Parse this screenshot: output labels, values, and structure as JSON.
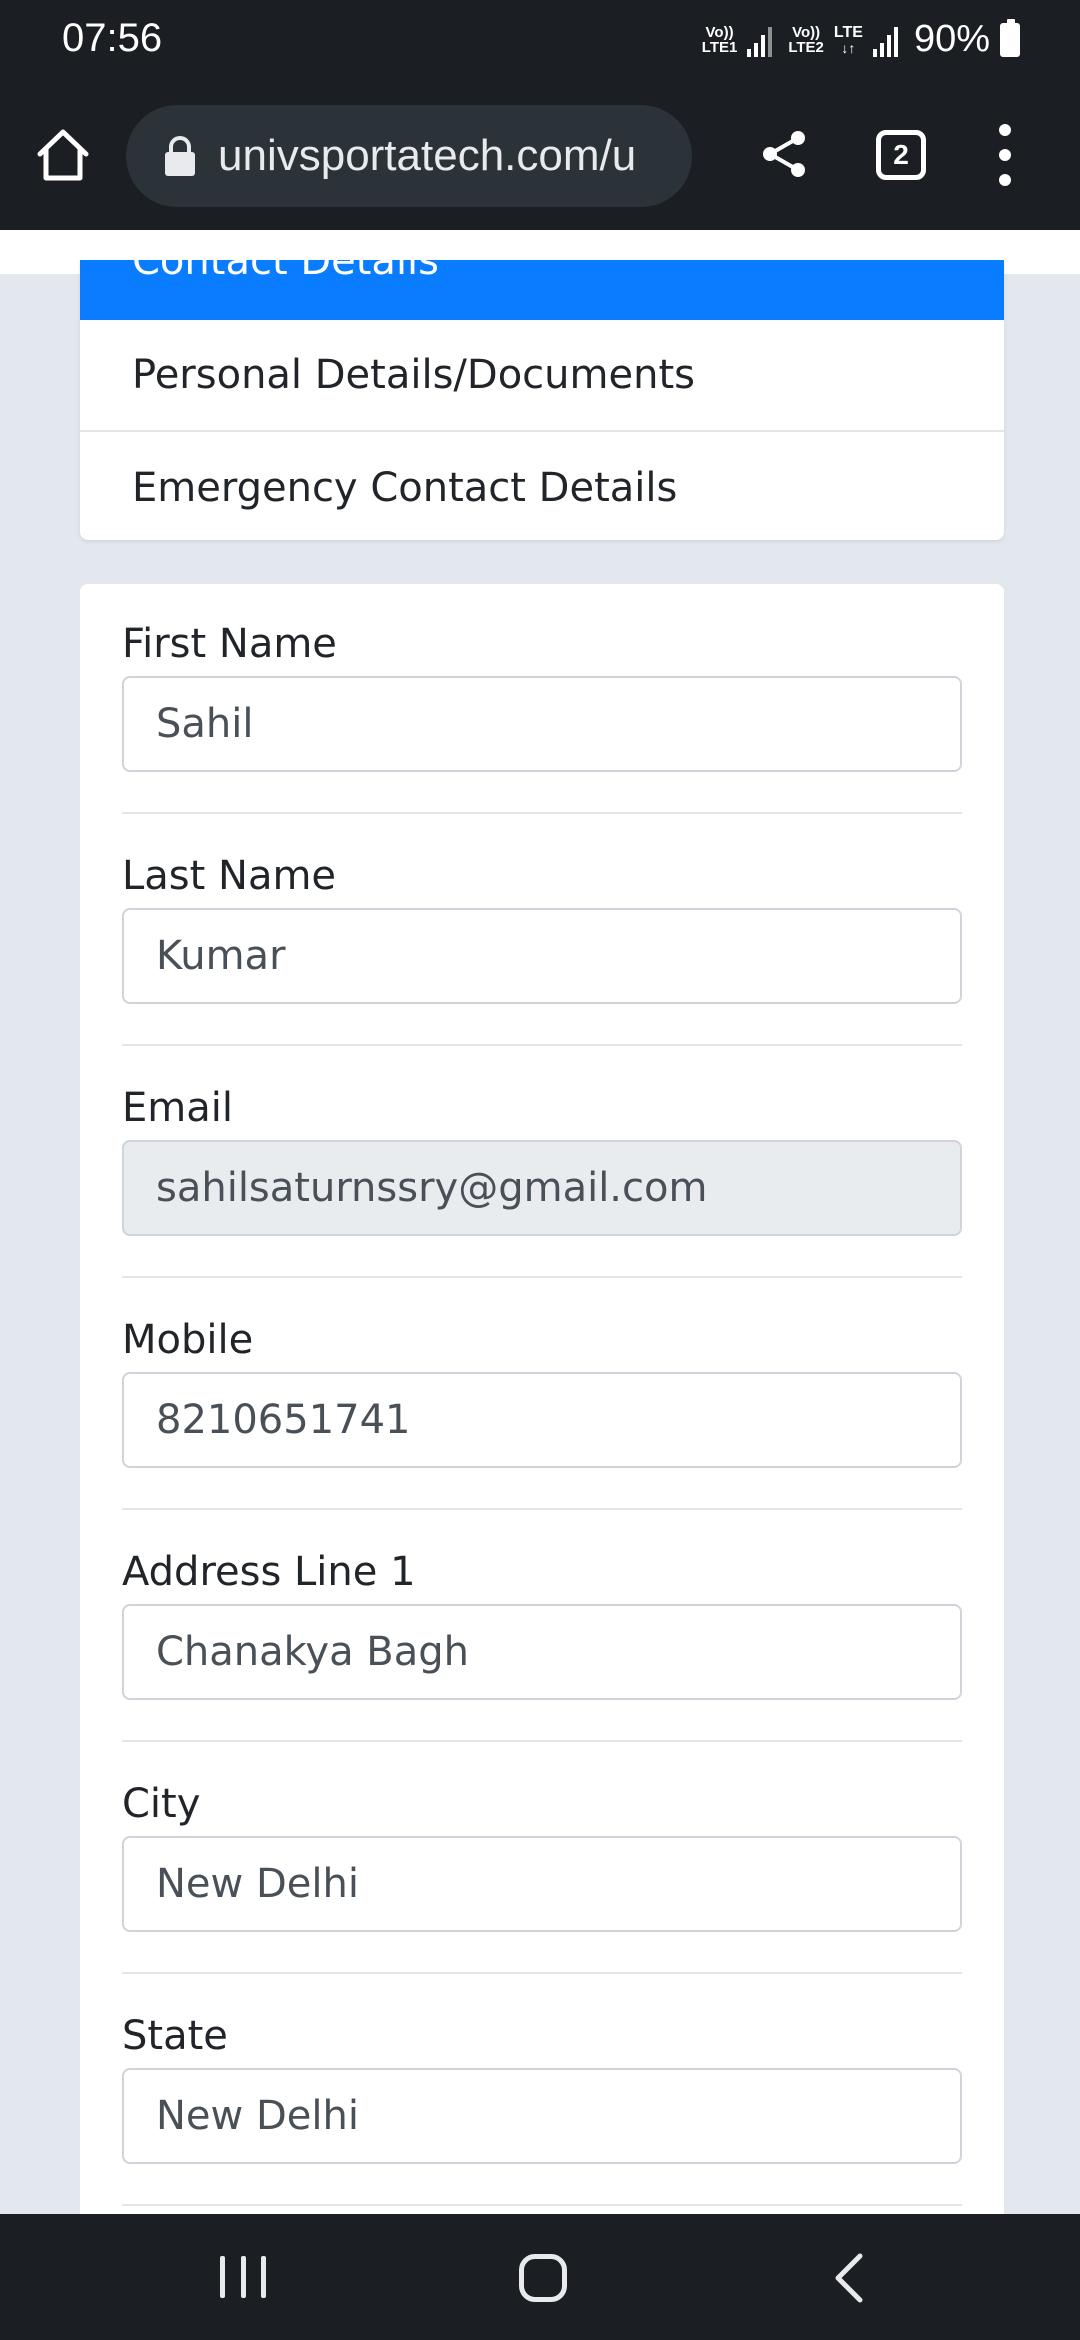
{
  "status_bar": {
    "time": "07:56",
    "sim1_label_top": "Vo))",
    "sim1_label_bottom": "LTE1",
    "sim2_label_top": "Vo))",
    "sim2_label_bottom": "LTE2",
    "data_label": "LTE",
    "battery_percent": "90%"
  },
  "browser": {
    "url": "univsportatech.com/u",
    "tab_count": "2"
  },
  "nav_menu": {
    "active_item": "Contact Details",
    "items": [
      {
        "label": "Personal Details/Documents"
      },
      {
        "label": "Emergency Contact Details"
      }
    ]
  },
  "form": {
    "fields": [
      {
        "label": "First Name",
        "value": "Sahil"
      },
      {
        "label": "Last Name",
        "value": "Kumar"
      },
      {
        "label": "Email",
        "value": "sahilsaturnssry@gmail.com",
        "readonly": true
      },
      {
        "label": "Mobile",
        "value": "8210651741"
      },
      {
        "label": "Address Line 1",
        "value": "Chanakya Bagh"
      },
      {
        "label": "City",
        "value": "New Delhi"
      },
      {
        "label": "State",
        "value": "New Delhi"
      }
    ]
  },
  "colors": {
    "accent": "#0a7cff",
    "page_background": "#e3e8ef",
    "system_bar": "#1b1f23"
  }
}
